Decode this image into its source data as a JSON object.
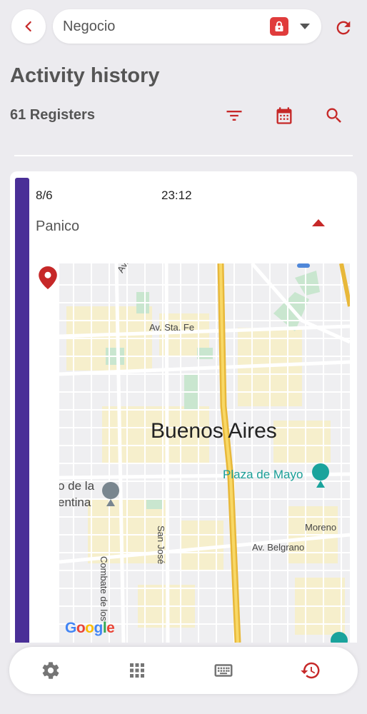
{
  "header": {
    "back_icon": "chevron-left-icon",
    "business_selector": "Negocio",
    "lock_icon": "lock-icon",
    "dropdown_icon": "caret-down-icon",
    "refresh_icon": "refresh-icon"
  },
  "page": {
    "title": "Activity history",
    "register_count": "61 Registers"
  },
  "toolbar": {
    "filter_icon": "filter-icon",
    "calendar_icon": "calendar-icon",
    "search_icon": "search-icon"
  },
  "activity": {
    "date": "8/6",
    "time": "23:12",
    "type": "Panico",
    "accent_color": "#4a2f97"
  },
  "map": {
    "city": "Buenos Aires",
    "place": "Plaza de Mayo",
    "streets": [
      "Av. Sta. Fe",
      "Moreno",
      "Av. Belgrano",
      "San José",
      "Combate de los",
      "o de la",
      "entina",
      "Av."
    ],
    "attribution": "Google"
  },
  "bottom_nav": {
    "items": [
      "settings-icon",
      "apps-grid-icon",
      "keyboard-icon",
      "history-icon"
    ],
    "active": "history-icon"
  },
  "colors": {
    "accent_red": "#c62828",
    "background": "#ecebef"
  }
}
